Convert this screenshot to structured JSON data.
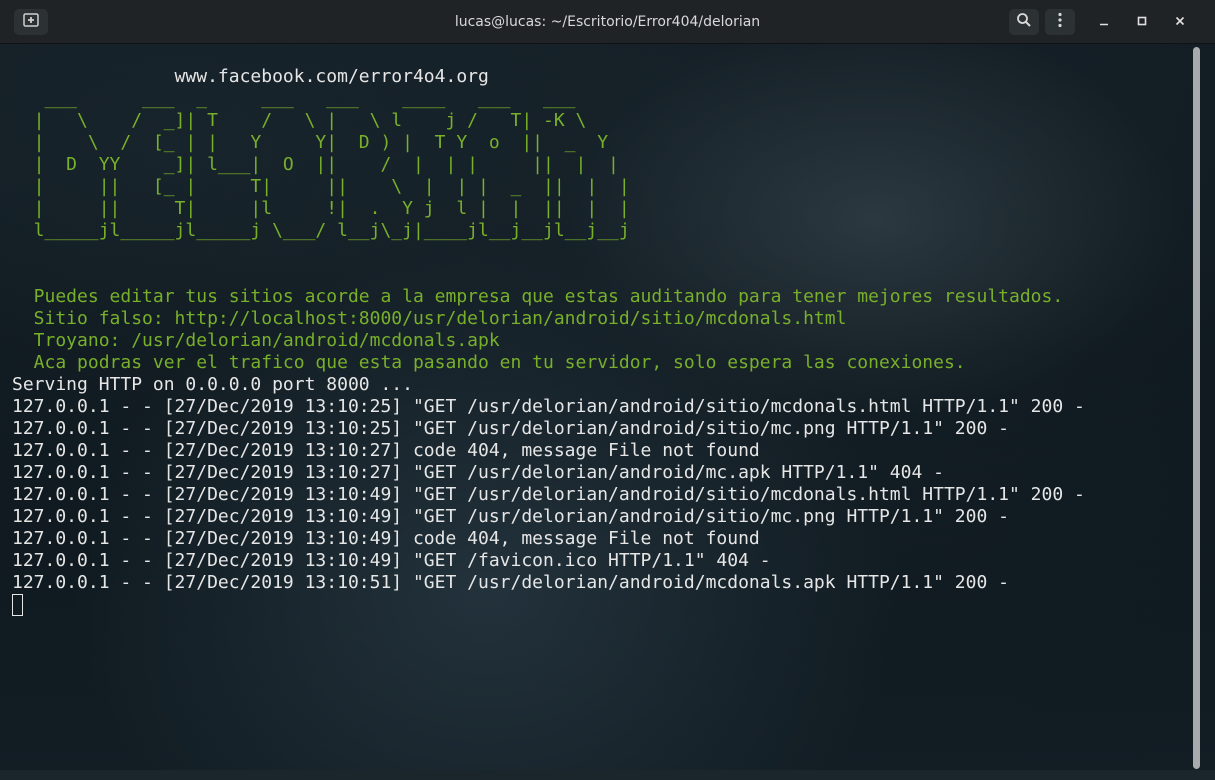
{
  "window": {
    "title": "lucas@lucas: ~/Escritorio/Error404/delorian"
  },
  "titlebar": {
    "new_tab_icon": "new-tab-icon",
    "search_icon": "search-icon",
    "menu_icon": "menu-icon",
    "minimize_icon": "minimize-icon",
    "maximize_icon": "maximize-icon",
    "close_icon": "close-icon"
  },
  "colors": {
    "green_text": "#78b02a",
    "white_text": "#e6e6e6",
    "titlebar_bg": "#1f2326"
  },
  "terminal": {
    "lines": [
      {
        "text": "",
        "color": "white"
      },
      {
        "text": "               www.facebook.com/error4o4.org",
        "color": "white"
      },
      {
        "text": "   ___      ___  _     ___   ___    ____   ___   ___",
        "color": "green"
      },
      {
        "text": "  |   \\    /  _]| T    /   \\ |   \\ l    j /   T| -K \\",
        "color": "green"
      },
      {
        "text": "  |    \\  /  [_ | |   Y     Y|  D ) |  T Y  o  ||  _  Y",
        "color": "green"
      },
      {
        "text": "  |  D  YY    _]| l___|  O  ||    /  |  | |     ||  |  |",
        "color": "green"
      },
      {
        "text": "  |     ||   [_ |     T|     ||    \\  |  | |  _  ||  |  |",
        "color": "green"
      },
      {
        "text": "  |     ||     T|     |l     !|  .  Y j  l |  |  ||  |  |",
        "color": "green"
      },
      {
        "text": "  l_____jl_____jl_____j \\___/ l__j\\_j|____jl__j__jl__j__j",
        "color": "green"
      },
      {
        "text": "",
        "color": "white"
      },
      {
        "text": "",
        "color": "white"
      },
      {
        "text": "  Puedes editar tus sitios acorde a la empresa que estas auditando para tener mejores resultados.",
        "color": "green"
      },
      {
        "text": "  Sitio falso: http://localhost:8000/usr/delorian/android/sitio/mcdonals.html",
        "color": "green"
      },
      {
        "text": "  Troyano: /usr/delorian/android/mcdonals.apk",
        "color": "green"
      },
      {
        "text": "  Aca podras ver el trafico que esta pasando en tu servidor, solo espera las conexiones.",
        "color": "green"
      },
      {
        "text": "Serving HTTP on 0.0.0.0 port 8000 ...",
        "color": "white"
      },
      {
        "text": "127.0.0.1 - - [27/Dec/2019 13:10:25] \"GET /usr/delorian/android/sitio/mcdonals.html HTTP/1.1\" 200 -",
        "color": "white"
      },
      {
        "text": "127.0.0.1 - - [27/Dec/2019 13:10:25] \"GET /usr/delorian/android/sitio/mc.png HTTP/1.1\" 200 -",
        "color": "white"
      },
      {
        "text": "127.0.0.1 - - [27/Dec/2019 13:10:27] code 404, message File not found",
        "color": "white"
      },
      {
        "text": "127.0.0.1 - - [27/Dec/2019 13:10:27] \"GET /usr/delorian/android/mc.apk HTTP/1.1\" 404 -",
        "color": "white"
      },
      {
        "text": "127.0.0.1 - - [27/Dec/2019 13:10:49] \"GET /usr/delorian/android/sitio/mcdonals.html HTTP/1.1\" 200 -",
        "color": "white"
      },
      {
        "text": "127.0.0.1 - - [27/Dec/2019 13:10:49] \"GET /usr/delorian/android/sitio/mc.png HTTP/1.1\" 200 -",
        "color": "white"
      },
      {
        "text": "127.0.0.1 - - [27/Dec/2019 13:10:49] code 404, message File not found",
        "color": "white"
      },
      {
        "text": "127.0.0.1 - - [27/Dec/2019 13:10:49] \"GET /favicon.ico HTTP/1.1\" 404 -",
        "color": "white"
      },
      {
        "text": "127.0.0.1 - - [27/Dec/2019 13:10:51] \"GET /usr/delorian/android/mcdonals.apk HTTP/1.1\" 200 -",
        "color": "white"
      }
    ]
  }
}
